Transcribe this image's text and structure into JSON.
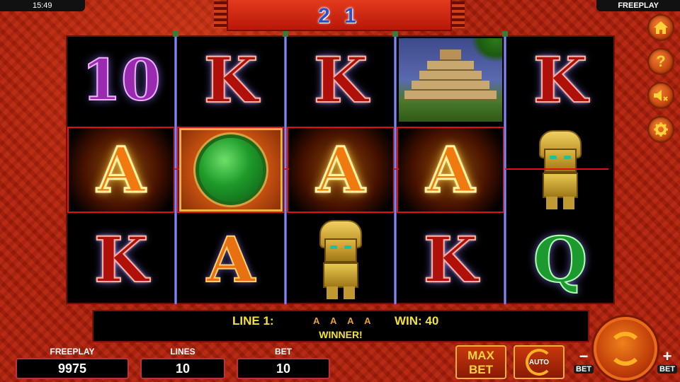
{
  "status_bar": {
    "time": "15:49",
    "mode": "FREEPLAY"
  },
  "counter": {
    "value": "2 1"
  },
  "reels": [
    [
      "10",
      "A",
      "K"
    ],
    [
      "K",
      "medallion",
      "A"
    ],
    [
      "K",
      "A",
      "idol"
    ],
    [
      "pyramid",
      "A",
      "K"
    ],
    [
      "K",
      "idol",
      "Q"
    ]
  ],
  "win_line": {
    "row": 2,
    "reels_highlighted": 4
  },
  "message": {
    "line_label": "LINE 1:",
    "symbols": "A A A A",
    "win_label": "WIN: 40",
    "result": "WINNER!"
  },
  "info": {
    "freeplay_label": "FREEPLAY",
    "freeplay_value": "9975",
    "lines_label": "LINES",
    "lines_value": "10",
    "bet_label": "BET",
    "bet_value": "10"
  },
  "controls": {
    "maxbet_line1": "MAX",
    "maxbet_line2": "BET",
    "auto_label": "AUTO",
    "bet_minus_sign": "−",
    "bet_minus_label": "BET",
    "bet_plus_sign": "+",
    "bet_plus_label": "BET"
  },
  "nav": {
    "home_icon": "home-icon",
    "help_glyph": "?",
    "sound_icon": "sound-muted-icon",
    "settings_icon": "gear-icon"
  }
}
